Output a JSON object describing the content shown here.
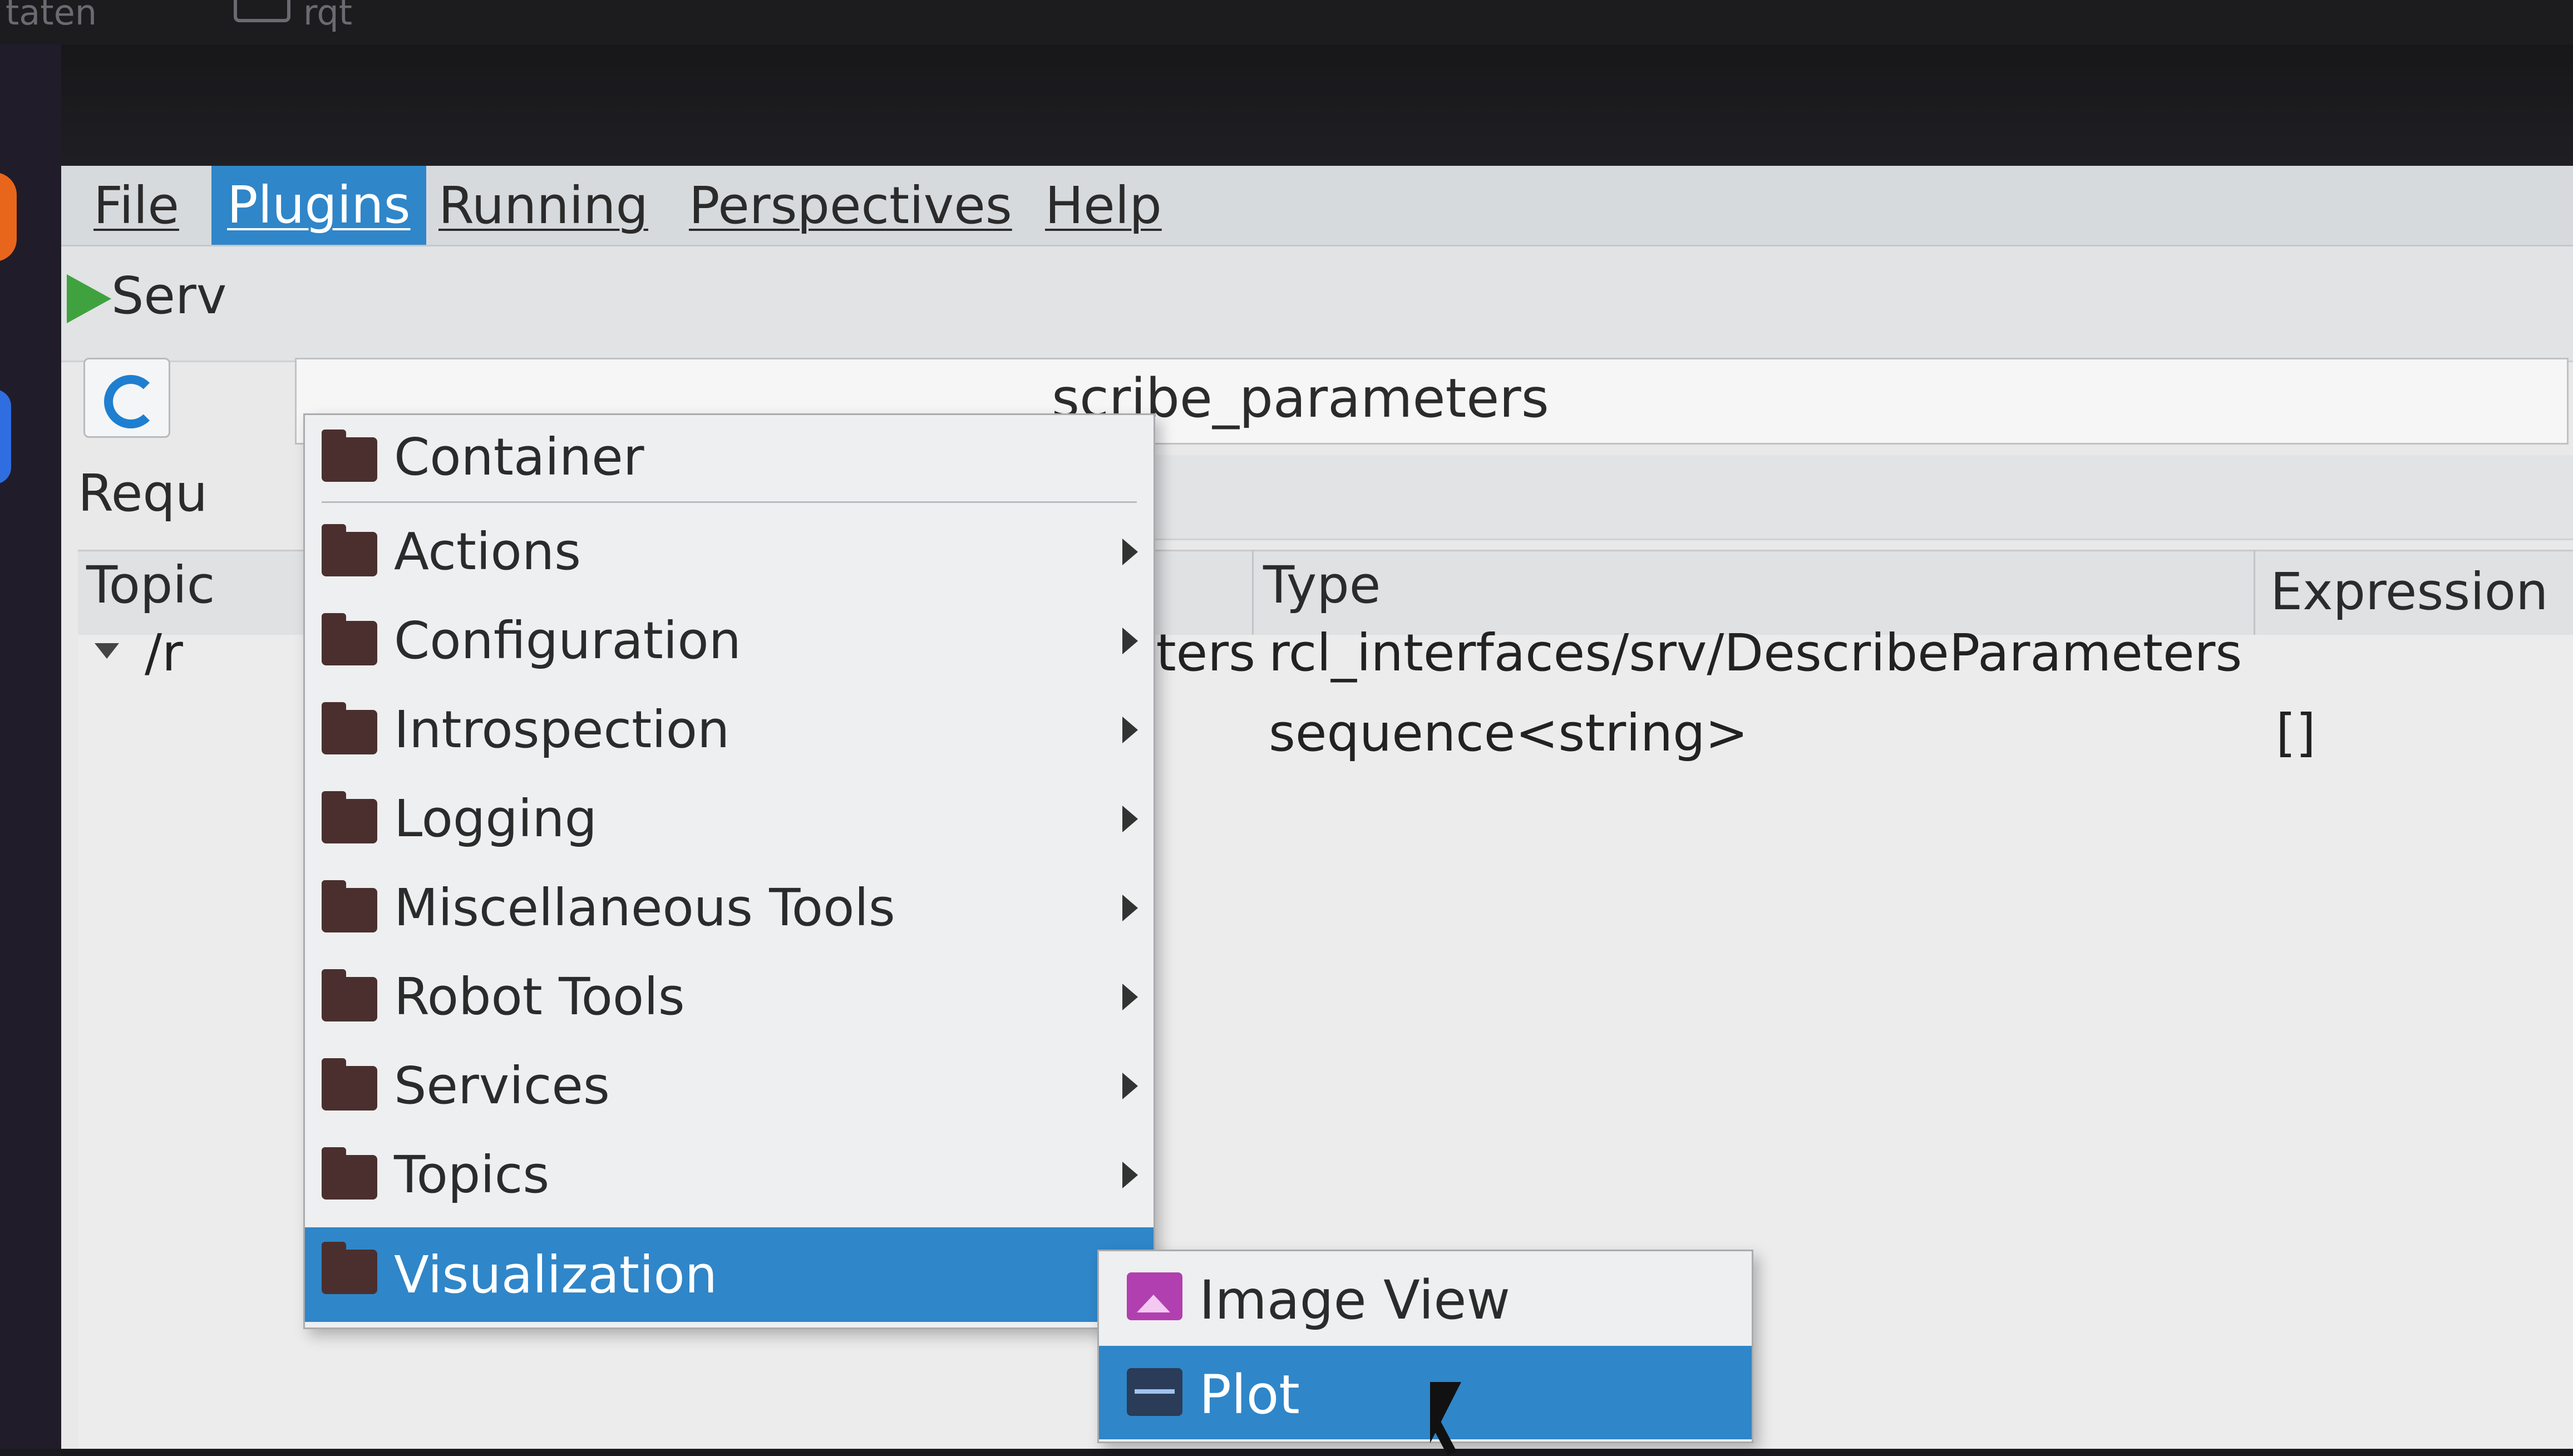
{
  "topbar": {
    "left_text": "taten",
    "app_text": "rqt"
  },
  "menubar": {
    "items": [
      "File",
      "Plugins",
      "Running",
      "Perspectives",
      "Help"
    ]
  },
  "toolbar": {
    "serv_label": "Serv"
  },
  "service": {
    "value_fragment": "scribe_parameters"
  },
  "request": {
    "label": "Requ"
  },
  "table": {
    "headers": {
      "topic": "Topic",
      "type": "Type",
      "expression": "Expression"
    },
    "rows": [
      {
        "topic": "/r",
        "name_fragment": "ameters",
        "type": "rcl_interfaces/srv/DescribeParameters",
        "expression": ""
      },
      {
        "topic": "",
        "name_fragment": "",
        "type": "sequence<string>",
        "expression": "[]"
      }
    ]
  },
  "plugins_menu": {
    "items": [
      {
        "label": "Container",
        "has_submenu": false
      },
      {
        "label": "Actions",
        "has_submenu": true
      },
      {
        "label": "Configuration",
        "has_submenu": true
      },
      {
        "label": "Introspection",
        "has_submenu": true
      },
      {
        "label": "Logging",
        "has_submenu": true
      },
      {
        "label": "Miscellaneous Tools",
        "has_submenu": true
      },
      {
        "label": "Robot Tools",
        "has_submenu": true
      },
      {
        "label": "Services",
        "has_submenu": true
      },
      {
        "label": "Topics",
        "has_submenu": true
      },
      {
        "label": "Visualization",
        "has_submenu": true,
        "highlighted": true
      }
    ]
  },
  "visualization_submenu": {
    "items": [
      {
        "label": "Image View",
        "icon": "image-view-icon"
      },
      {
        "label": "Plot",
        "icon": "plot-icon",
        "highlighted": true
      }
    ]
  },
  "colors": {
    "highlight": "#2f86c9",
    "folder": "#4a2f2e",
    "play": "#3fa23f"
  }
}
